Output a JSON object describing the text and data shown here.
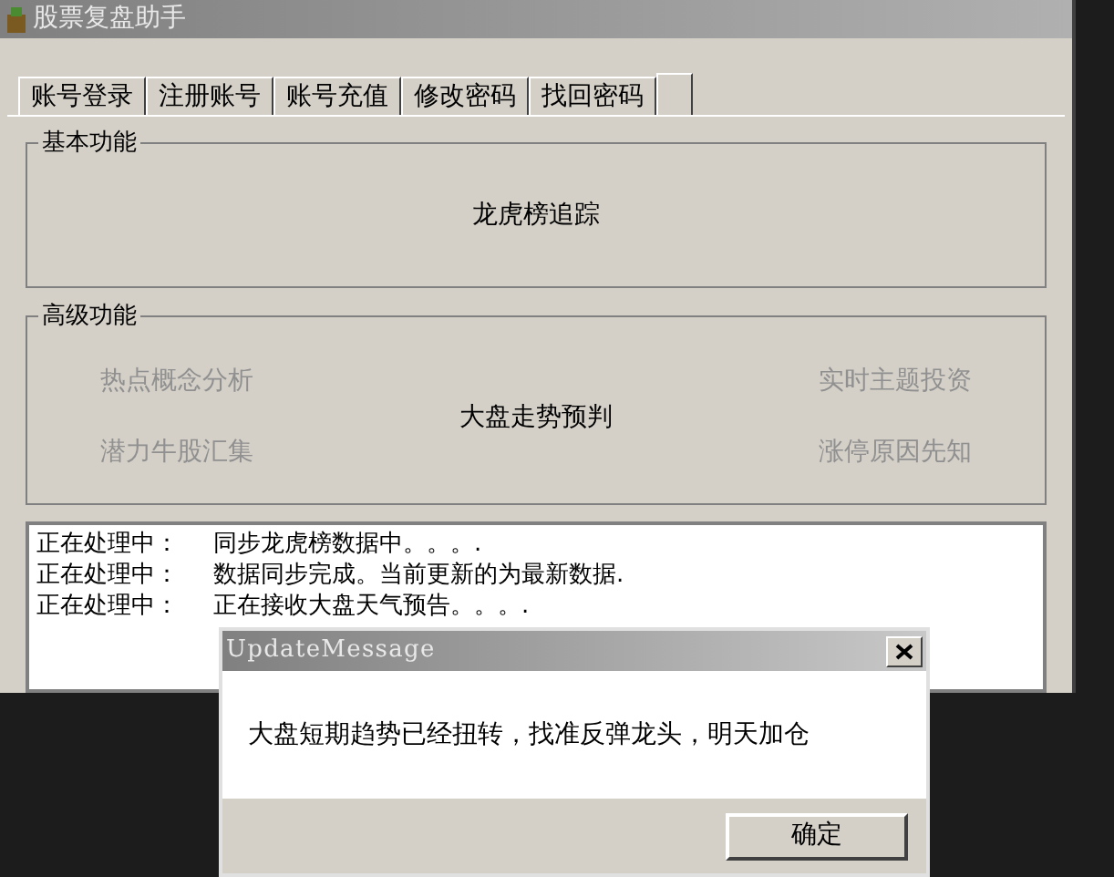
{
  "window": {
    "title": "股票复盘助手"
  },
  "tabs": [
    {
      "label": "账号登录",
      "selected": false
    },
    {
      "label": "注册账号",
      "selected": false
    },
    {
      "label": "账号充值",
      "selected": false
    },
    {
      "label": "修改密码",
      "selected": false
    },
    {
      "label": "找回密码",
      "selected": false
    },
    {
      "selected": true
    }
  ],
  "basic": {
    "title": "基本功能",
    "buttons": [
      {
        "label": "龙虎榜追踪",
        "disabled": false
      }
    ]
  },
  "advanced": {
    "title": "高级功能",
    "left": [
      {
        "label": "热点概念分析",
        "disabled": true
      },
      {
        "label": "潜力牛股汇集",
        "disabled": true
      }
    ],
    "center": {
      "label": "大盘走势预判",
      "disabled": false
    },
    "right": [
      {
        "label": "实时主题投资",
        "disabled": true
      },
      {
        "label": "涨停原因先知",
        "disabled": true
      }
    ]
  },
  "log": [
    {
      "label": "正在处理中：",
      "message": "同步龙虎榜数据中。。。."
    },
    {
      "label": "正在处理中：",
      "message": "数据同步完成。当前更新的为最新数据."
    },
    {
      "label": "正在处理中：",
      "message": "正在接收大盘天气预告。。。."
    }
  ],
  "dialog": {
    "title": "UpdateMessage",
    "message": "大盘短期趋势已经扭转，找准反弹龙头，明天加仓",
    "button": "确定"
  }
}
